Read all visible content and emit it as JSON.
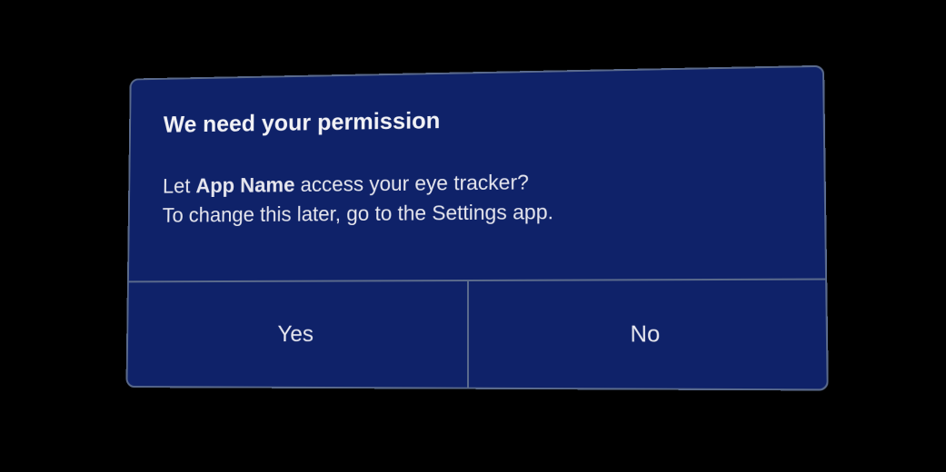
{
  "dialog": {
    "title": "We need your permission",
    "message_pre": "Let ",
    "app_name": "App Name",
    "message_post": " access your eye tracker?",
    "message_line2": "To change this later, go to the Settings app.",
    "buttons": {
      "yes": "Yes",
      "no": "No"
    }
  }
}
